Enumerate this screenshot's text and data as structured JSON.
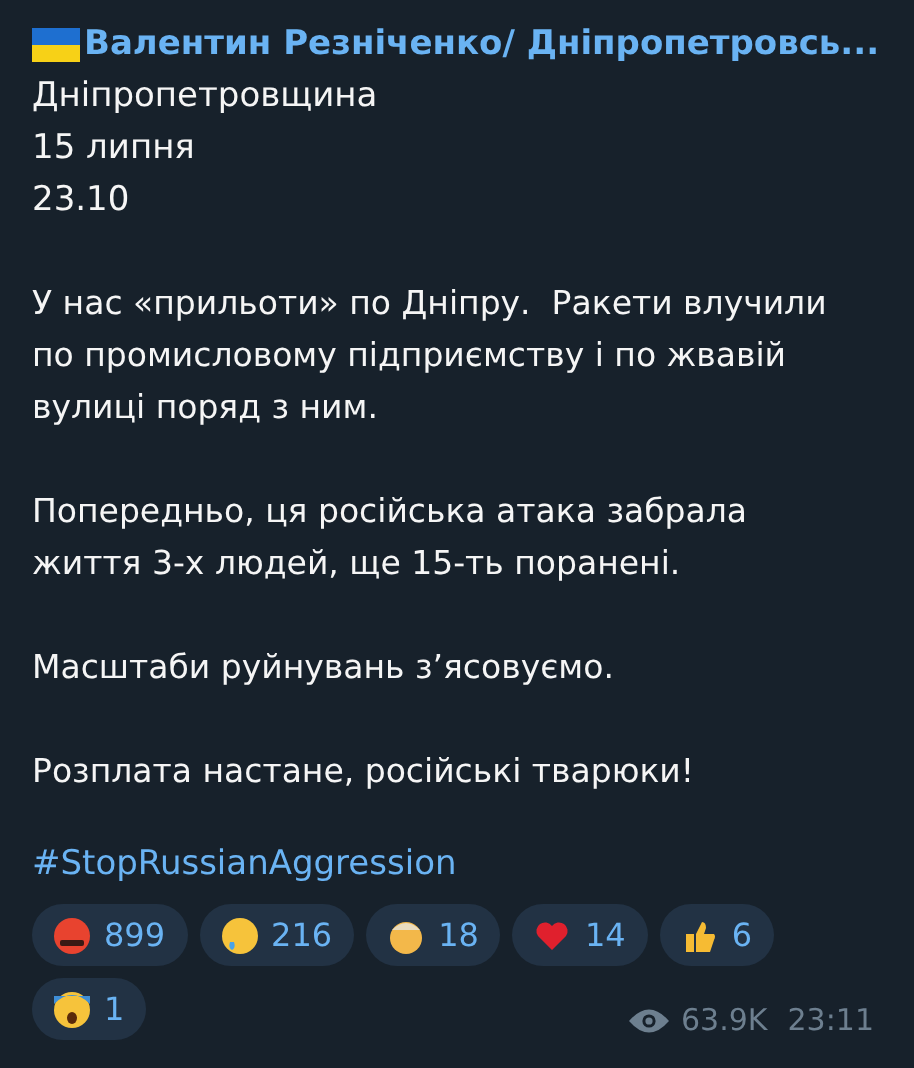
{
  "message": {
    "author": "Валентин Резніченко/ Дніпропетровсь...",
    "header_lines": [
      "Дніпропетровщина",
      "15 липня",
      "23.10"
    ],
    "paragraphs": [
      {
        "lines": [
          "У нас «прильоти» по Дніпру.  Ракети влучили",
          "по промисловому підприємству і по жвавій",
          "вулиці поряд з ним."
        ]
      },
      {
        "lines": [
          "Попередньо, ця російська атака забрала",
          "життя 3-х людей, ще 15-ть поранені."
        ]
      },
      {
        "lines": [
          "Масштаби руйнувань зʼясовуємо."
        ]
      },
      {
        "lines": [
          "Розплата настане, російські тварюки!"
        ]
      }
    ],
    "hashtag": "#StopRussianAggression",
    "reactions": [
      {
        "kind": "cursing",
        "count": "899"
      },
      {
        "kind": "crying",
        "count": "216"
      },
      {
        "kind": "mindblown",
        "count": "18"
      },
      {
        "kind": "heart",
        "count": "14"
      },
      {
        "kind": "thumbsup",
        "count": "6"
      },
      {
        "kind": "scream",
        "count": "1"
      }
    ],
    "views": "63.9K",
    "time": "23:11"
  }
}
